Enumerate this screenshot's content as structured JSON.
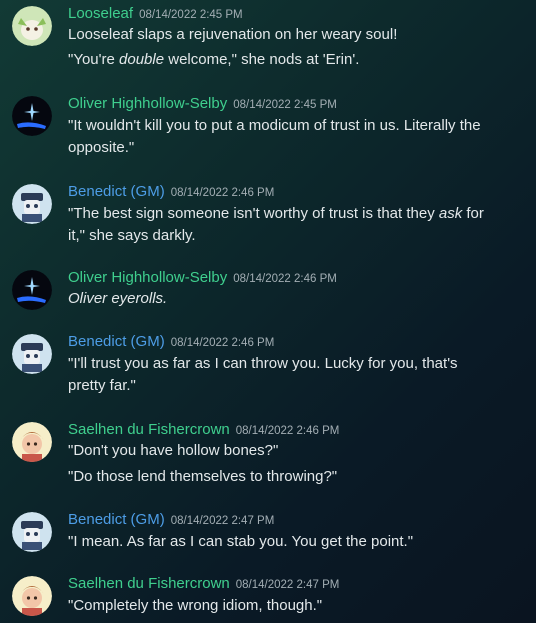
{
  "colors": {
    "green_name": "#3fcf8e",
    "blue_name": "#4d9de6",
    "text": "#e3e8ea",
    "timestamp": "#a3aeb4"
  },
  "messages": [
    {
      "author": "Looseleaf",
      "time": "08/14/2022 2:45 PM",
      "avatar": "leaf-creature-avatar",
      "lines": [
        {
          "segments": [
            {
              "text": "Looseleaf slaps a rejuvenation on her weary soul!"
            }
          ]
        },
        {
          "segments": [
            {
              "text": "\"You're "
            },
            {
              "text": "double",
              "italic": true
            },
            {
              "text": " welcome,\" she nods at 'Erin'."
            }
          ]
        }
      ]
    },
    {
      "author": "Oliver Highhollow-Selby",
      "time": "08/14/2022 2:45 PM",
      "avatar": "sparkle-hand-avatar",
      "lines": [
        {
          "segments": [
            {
              "text": "\"It wouldn't kill you to put a modicum of trust in us. Literally the opposite.\""
            }
          ]
        }
      ]
    },
    {
      "author": "Benedict (GM)",
      "time": "08/14/2022 2:46 PM",
      "avatar": "masked-figure-avatar",
      "lines": [
        {
          "segments": [
            {
              "text": "\"The best sign someone isn't worthy of trust is that they "
            },
            {
              "text": "ask",
              "italic": true
            },
            {
              "text": " for it,\" she says darkly."
            }
          ]
        }
      ]
    },
    {
      "author": "Oliver Highhollow-Selby",
      "time": "08/14/2022 2:46 PM",
      "avatar": "sparkle-hand-avatar",
      "lines": [
        {
          "segments": [
            {
              "text": "Oliver eyerolls.",
              "italic": true
            }
          ]
        }
      ]
    },
    {
      "author": "Benedict (GM)",
      "time": "08/14/2022 2:46 PM",
      "avatar": "masked-figure-avatar",
      "lines": [
        {
          "segments": [
            {
              "text": "\"I'll trust you as far as I can throw you. Lucky for you, that's pretty far.\""
            }
          ]
        }
      ]
    },
    {
      "author": "Saelhen du Fishercrown",
      "time": "08/14/2022 2:46 PM",
      "avatar": "bird-girl-avatar",
      "lines": [
        {
          "segments": [
            {
              "text": "\"Don't you have hollow bones?\""
            }
          ]
        },
        {
          "segments": [
            {
              "text": "\"Do those lend themselves to throwing?\""
            }
          ]
        }
      ]
    },
    {
      "author": "Benedict (GM)",
      "time": "08/14/2022 2:47 PM",
      "avatar": "masked-figure-avatar",
      "lines": [
        {
          "segments": [
            {
              "text": "\"I mean. As far as I can stab you. You get the point.\""
            }
          ]
        }
      ]
    },
    {
      "author": "Saelhen du Fishercrown",
      "time": "08/14/2022 2:47 PM",
      "avatar": "bird-girl-avatar",
      "lines": [
        {
          "segments": [
            {
              "text": "\"Completely the wrong idiom, though.\""
            }
          ]
        }
      ]
    }
  ]
}
